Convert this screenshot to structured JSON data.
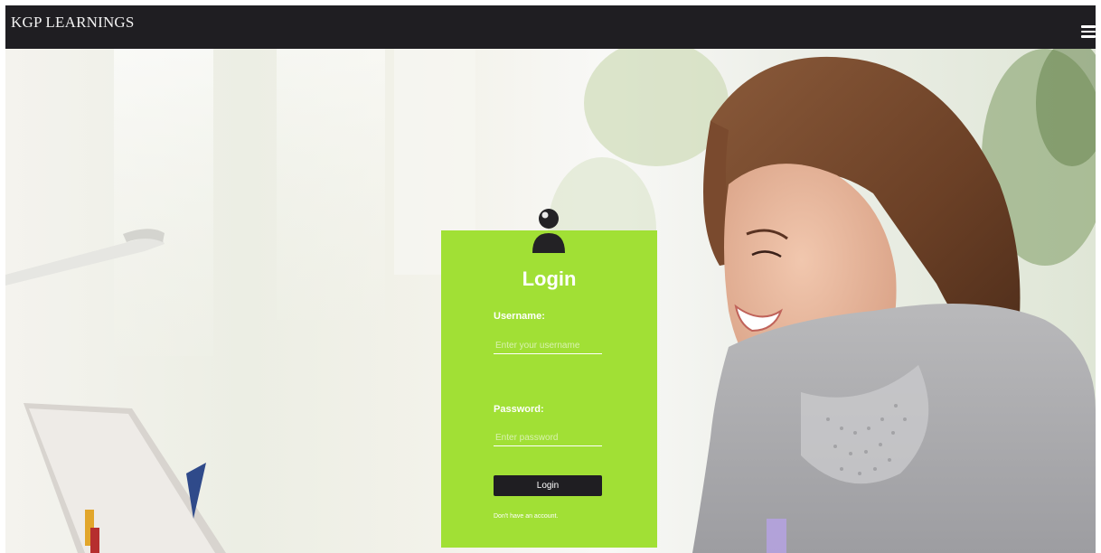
{
  "navbar": {
    "brand": "KGP LEARNINGS",
    "menu_icon": "hamburger-menu-icon",
    "background": "#1f1e22"
  },
  "hero": {
    "description_icon": "photo-background"
  },
  "login": {
    "title": "Login",
    "icon": "user-icon",
    "card_color": "#a1e035",
    "username": {
      "label": "Username:",
      "placeholder": "Enter your username",
      "value": ""
    },
    "password": {
      "label": "Password:",
      "placeholder": "Enter password",
      "value": ""
    },
    "submit_label": "Login",
    "signup_text": "Don't have an account."
  }
}
